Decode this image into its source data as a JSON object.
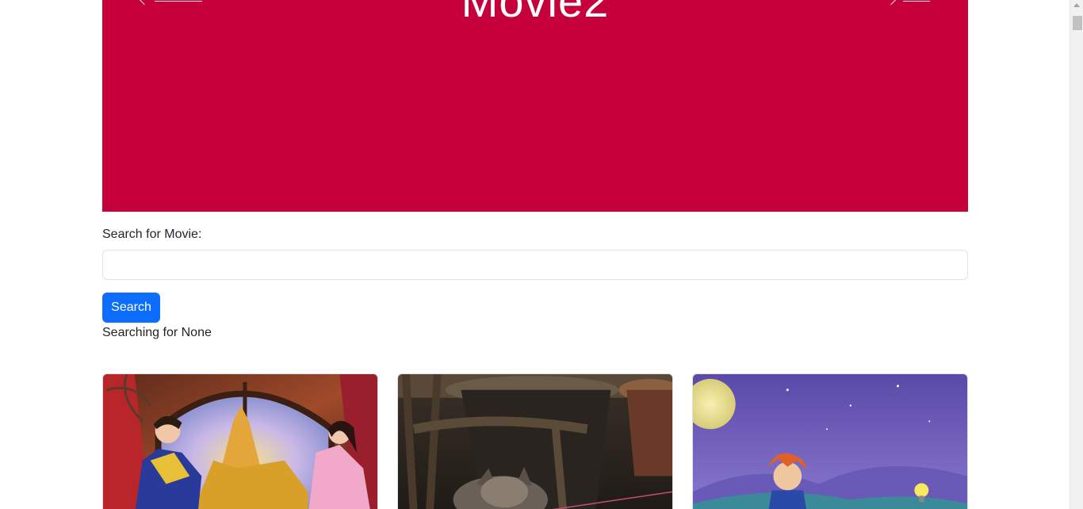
{
  "carousel": {
    "slide_title": "Movie2",
    "background_color": "#c6003a",
    "prev_icon": "chevron-left-icon",
    "next_icon": "chevron-right-icon"
  },
  "search": {
    "label": "Search for Movie:",
    "value": "",
    "placeholder": "",
    "button_label": "Search",
    "button_color": "#0d6efd",
    "status_text": "Searching for None"
  },
  "cards": [
    {
      "image": "fairytale-prince-princess-illustration"
    },
    {
      "image": "cat-among-pots-photo"
    },
    {
      "image": "boy-night-sky-lightbulb-illustration"
    }
  ]
}
